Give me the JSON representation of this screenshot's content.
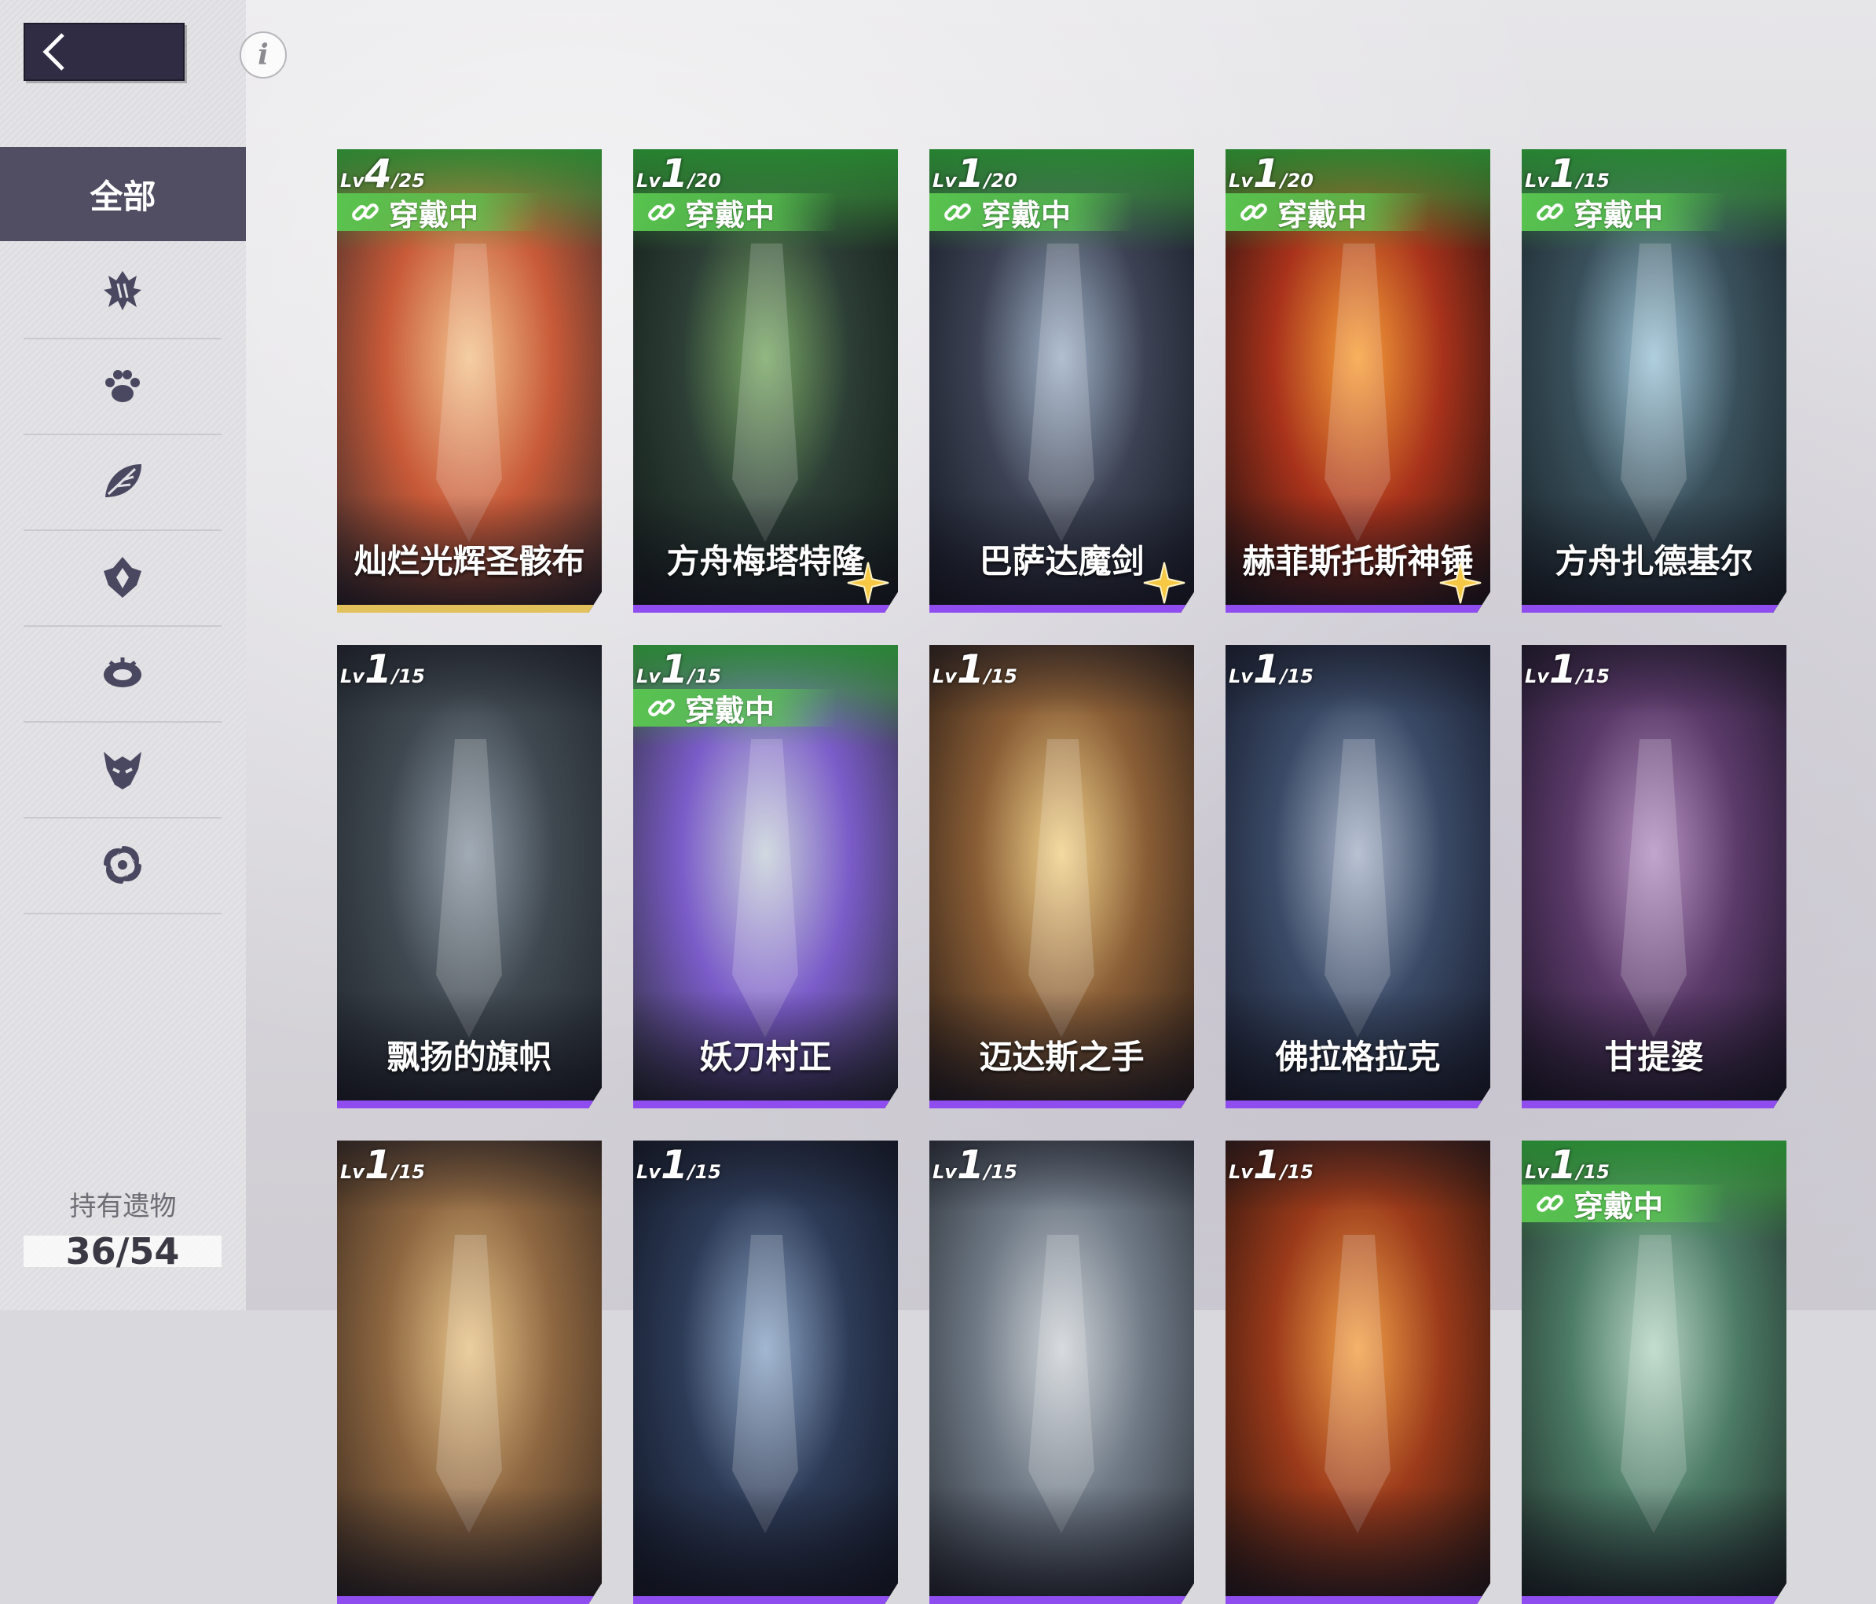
{
  "sidebar": {
    "active_category": "全部",
    "categories": [
      "claw-icon",
      "paw-icon",
      "leaf-icon",
      "flame-crest-icon",
      "ring-icon",
      "demon-mask-icon",
      "spiral-icon"
    ],
    "owned_label": "持有遗物",
    "owned_count": "36/54"
  },
  "cards": [
    {
      "name": "灿烂光辉圣骸布",
      "lv_prefix": "Lv",
      "level": "4",
      "max": "/25",
      "equipped": true,
      "equip_label": "穿戴中",
      "rarity": "gold",
      "star": false,
      "palette": [
        "#f3c48e",
        "#c85a38",
        "#3a2a2a"
      ]
    },
    {
      "name": "方舟梅塔特隆",
      "lv_prefix": "Lv",
      "level": "1",
      "max": "/20",
      "equipped": true,
      "equip_label": "穿戴中",
      "rarity": "purple",
      "star": true,
      "palette": [
        "#7aa866",
        "#2c3e35",
        "#121a18"
      ]
    },
    {
      "name": "巴萨达魔剑",
      "lv_prefix": "Lv",
      "level": "1",
      "max": "/20",
      "equipped": true,
      "equip_label": "穿戴中",
      "rarity": "purple",
      "star": true,
      "palette": [
        "#9fb1c7",
        "#3c4253",
        "#131722"
      ]
    },
    {
      "name": "赫菲斯托斯神锤",
      "lv_prefix": "Lv",
      "level": "1",
      "max": "/20",
      "equipped": true,
      "equip_label": "穿戴中",
      "rarity": "purple",
      "star": true,
      "palette": [
        "#f7a13a",
        "#a8321b",
        "#1c0f0e"
      ]
    },
    {
      "name": "方舟扎德基尔",
      "lv_prefix": "Lv",
      "level": "1",
      "max": "/15",
      "equipped": true,
      "equip_label": "穿戴中",
      "rarity": "purple",
      "star": false,
      "palette": [
        "#9ec5d8",
        "#39505b",
        "#182228"
      ]
    },
    {
      "name": "飘扬的旗帜",
      "lv_prefix": "Lv",
      "level": "1",
      "max": "/15",
      "equipped": false,
      "equip_label": "",
      "rarity": "purple",
      "star": false,
      "palette": [
        "#8d99a5",
        "#3f4850",
        "#20252b"
      ]
    },
    {
      "name": "妖刀村正",
      "lv_prefix": "Lv",
      "level": "1",
      "max": "/15",
      "equipped": true,
      "equip_label": "穿戴中",
      "rarity": "purple",
      "star": false,
      "palette": [
        "#c7d1d9",
        "#7b5cc9",
        "#2d2f3a"
      ]
    },
    {
      "name": "迈达斯之手",
      "lv_prefix": "Lv",
      "level": "1",
      "max": "/15",
      "equipped": false,
      "equip_label": "",
      "rarity": "purple",
      "star": false,
      "palette": [
        "#f1d28b",
        "#8a5e36",
        "#2a1c14"
      ]
    },
    {
      "name": "佛拉格拉克",
      "lv_prefix": "Lv",
      "level": "1",
      "max": "/15",
      "equipped": false,
      "equip_label": "",
      "rarity": "purple",
      "star": false,
      "palette": [
        "#a8b4c8",
        "#3a4a66",
        "#15192a"
      ]
    },
    {
      "name": "甘提婆",
      "lv_prefix": "Lv",
      "level": "1",
      "max": "/15",
      "equipped": false,
      "equip_label": "",
      "rarity": "purple",
      "star": false,
      "palette": [
        "#b592c2",
        "#5b3a6a",
        "#1c1426"
      ]
    },
    {
      "name": "",
      "lv_prefix": "Lv",
      "level": "1",
      "max": "/15",
      "equipped": false,
      "equip_label": "",
      "rarity": "purple",
      "star": false,
      "palette": [
        "#e7c48a",
        "#8e6741",
        "#3a2a1e"
      ]
    },
    {
      "name": "",
      "lv_prefix": "Lv",
      "level": "1",
      "max": "/15",
      "equipped": false,
      "equip_label": "",
      "rarity": "purple",
      "star": false,
      "palette": [
        "#8ea7c7",
        "#2d3b57",
        "#0f1422"
      ]
    },
    {
      "name": "",
      "lv_prefix": "Lv",
      "level": "1",
      "max": "/15",
      "equipped": false,
      "equip_label": "",
      "rarity": "purple",
      "star": false,
      "palette": [
        "#cfd3d8",
        "#6f7a86",
        "#2b3038"
      ]
    },
    {
      "name": "",
      "lv_prefix": "Lv",
      "level": "1",
      "max": "/15",
      "equipped": false,
      "equip_label": "",
      "rarity": "purple",
      "star": false,
      "palette": [
        "#f2a24a",
        "#9b3a1a",
        "#2a140d"
      ]
    },
    {
      "name": "",
      "lv_prefix": "Lv",
      "level": "1",
      "max": "/15",
      "equipped": true,
      "equip_label": "穿戴中",
      "rarity": "purple",
      "star": false,
      "palette": [
        "#b7d6c4",
        "#4c7b66",
        "#1f2e28"
      ]
    }
  ],
  "colors": {
    "rarity_purple": "#8f4df0",
    "rarity_gold": "#e2c15c",
    "equip_green": "#5ac850"
  }
}
